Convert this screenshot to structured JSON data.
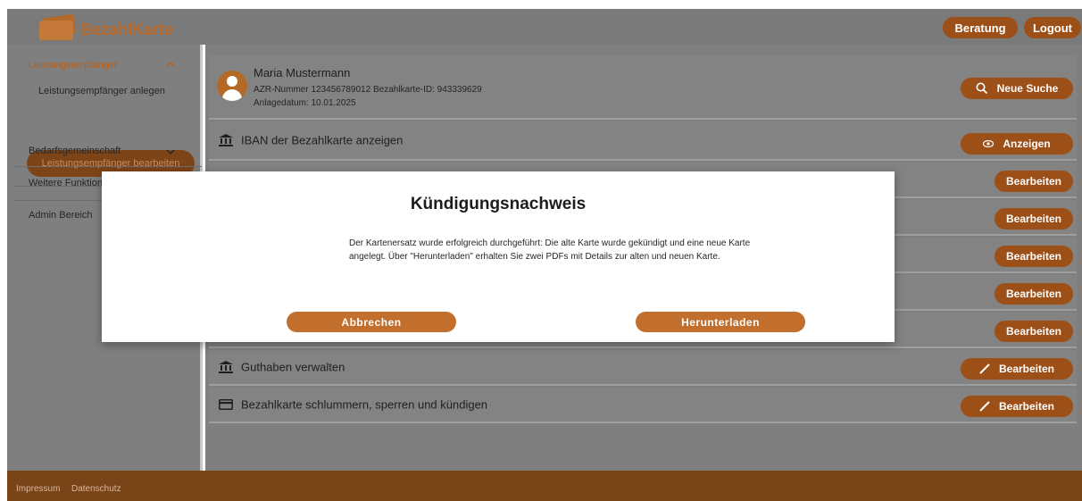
{
  "header": {
    "brand": "BezahlKarte",
    "beratung_label": "Beratung",
    "logout_label": "Logout"
  },
  "sidebar": {
    "group_title": "Leistungsempfänger",
    "sub_items": [
      "Leistungsempfänger anlegen",
      "Leistungsempfänger bearbeiten"
    ],
    "bedarfsgemeinschaft": "Bedarfsgemeinschaft",
    "weitere": "Weitere Funktione",
    "admin": "Admin Bereich"
  },
  "person": {
    "name": "Maria Mustermann",
    "ids": "AZR-Nummer 123456789012  Bezahlkarte-ID: 943339629",
    "date": "Anlagedatum: 10.01.2025",
    "search_label": "Neue Suche"
  },
  "rows": [
    {
      "label": "IBAN der Bezahlkarte anzeigen",
      "action": "Anzeigen",
      "icon": "bank-icon"
    },
    {
      "label": "",
      "action": "Bearbeiten"
    },
    {
      "label": "",
      "action": "Bearbeiten"
    },
    {
      "label": "",
      "action": "Bearbeiten"
    },
    {
      "label": "",
      "action": "Bearbeiten"
    },
    {
      "label": "",
      "action": "Bearbeiten"
    },
    {
      "label": "Guthaben verwalten",
      "action": "Bearbeiten",
      "icon": "bank-icon"
    },
    {
      "label": "Bezahlkarte schlummern, sperren und kündigen",
      "action": "Bearbeiten",
      "icon": "card-icon"
    }
  ],
  "modal": {
    "title": "Kündigungsnachweis",
    "text": "Der Kartenersatz wurde erfolgreich durchgeführt: Die alte Karte wurde gekündigt und eine neue Karte angelegt. Über \"Herunterladen\" erhalten Sie zwei PDFs mit Details zur alten und neuen Karte.",
    "cancel_label": "Abbrechen",
    "download_label": "Herunterladen"
  },
  "footer": {
    "impressum": "Impressum",
    "datenschutz": "Datenschutz"
  },
  "colors": {
    "accent": "#9c4f17",
    "modal_button": "#c26e2c",
    "footer": "#7a4419"
  }
}
